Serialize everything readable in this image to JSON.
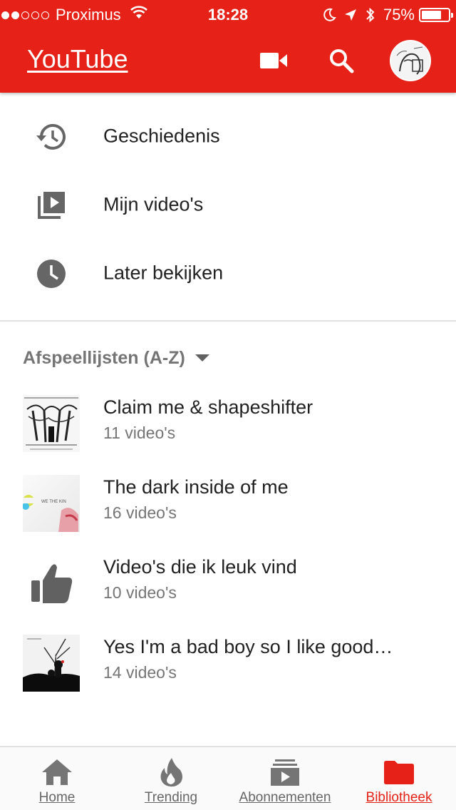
{
  "status_bar": {
    "signal_dots_filled": 2,
    "signal_dots_total": 5,
    "carrier": "Proximus",
    "time": "18:28",
    "battery_percent": "75%",
    "battery_level": 0.75
  },
  "app_bar": {
    "title": "YouTube",
    "icons": [
      "video-camera-icon",
      "search-icon",
      "account-avatar"
    ]
  },
  "menu": {
    "items": [
      {
        "label": "Geschiedenis",
        "icon": "history-icon"
      },
      {
        "label": "Mijn video's",
        "icon": "my-videos-icon"
      },
      {
        "label": "Later bekijken",
        "icon": "watch-later-icon"
      }
    ]
  },
  "playlists": {
    "header": "Afspeellijsten (A-Z)",
    "items": [
      {
        "title": "Claim me & shapeshifter",
        "count": "11 video's",
        "thumb": "sketch-tree-thumbnail"
      },
      {
        "title": "The dark inside of me",
        "count": "16 video's",
        "thumb": "colorful-thumbnail",
        "thumb_text": "WE THE KIN"
      },
      {
        "title": "Video's die ik leuk vind",
        "count": "10 video's",
        "thumb": "thumbs-up-icon"
      },
      {
        "title": "Yes I'm a bad boy so I like good…",
        "count": "14 video's",
        "thumb": "dark-silhouette-thumbnail"
      }
    ]
  },
  "bottom_nav": {
    "items": [
      {
        "label": "Home",
        "icon": "home-icon"
      },
      {
        "label": "Trending",
        "icon": "flame-icon"
      },
      {
        "label": "Abonnementen",
        "icon": "subscriptions-icon"
      },
      {
        "label": "Bibliotheek",
        "icon": "folder-icon",
        "active": true
      }
    ]
  },
  "colors": {
    "brand_red": "#e62117",
    "icon_gray": "#666666",
    "text_primary": "#212121",
    "text_secondary": "#757575"
  }
}
